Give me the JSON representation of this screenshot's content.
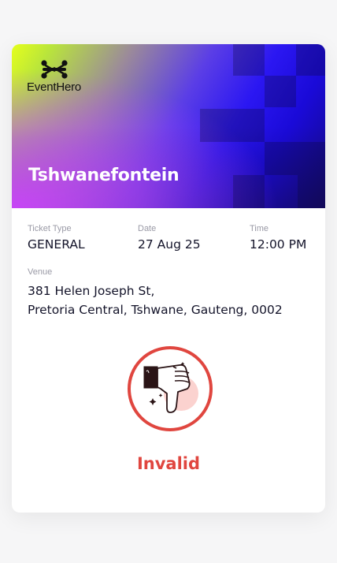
{
  "brand": {
    "name": "EventHero"
  },
  "event": {
    "title": "Tshwanefontein"
  },
  "ticket": {
    "type_label": "Ticket Type",
    "type_value": "GENERAL",
    "date_label": "Date",
    "date_value": "27 Aug 25",
    "time_label": "Time",
    "time_value": "12:00 PM",
    "venue_label": "Venue",
    "venue_line1": "381 Helen Joseph St,",
    "venue_line2": "Pretoria Central, Tshwane, Gauteng, 0002"
  },
  "status": {
    "label": "Invalid",
    "icon": "thumbs-down-icon",
    "color": "#e0463f"
  },
  "colors": {
    "gradient_lime": "#e5ff1c",
    "gradient_purple": "#cb42ff",
    "gradient_blue": "#2b17f2",
    "card_background": "#ffffff",
    "page_background": "#f6f6f7"
  }
}
